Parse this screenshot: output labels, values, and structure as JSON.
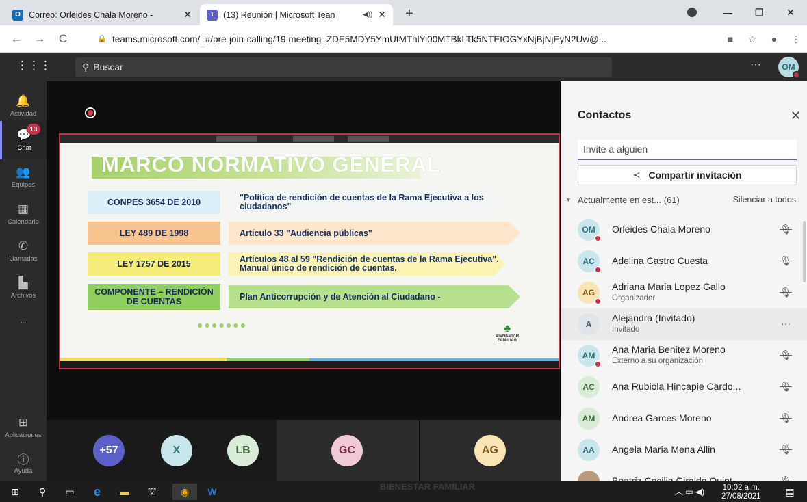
{
  "browser": {
    "tabs": [
      {
        "title": "Correo: Orleides Chala Moreno -",
        "favicon": "outlook-icon",
        "active": false
      },
      {
        "title": "(13) Reunión | Microsoft Tean",
        "favicon": "teams-icon",
        "active": true
      }
    ],
    "new_tab": "+",
    "url": "teams.microsoft.com/_#/pre-join-calling/19:meeting_ZDE5MDY5YmUtMThlYi00MTBkLTk5NTEtOGYxNjBjNjEyN2Uw@..."
  },
  "teams": {
    "search_placeholder": "Buscar",
    "me_initials": "OM",
    "rail": [
      {
        "label": "Actividad",
        "icon": "bell-icon"
      },
      {
        "label": "Chat",
        "icon": "chat-icon",
        "badge": "13",
        "active": true
      },
      {
        "label": "Equipos",
        "icon": "teams-icon"
      },
      {
        "label": "Calendario",
        "icon": "calendar-icon"
      },
      {
        "label": "Llamadas",
        "icon": "phone-icon"
      },
      {
        "label": "Archivos",
        "icon": "file-icon"
      },
      {
        "label": "...",
        "icon": "more-icon"
      }
    ],
    "rail_bottom": [
      {
        "label": "Aplicaciones",
        "icon": "apps-icon"
      },
      {
        "label": "Ayuda",
        "icon": "help-icon"
      }
    ]
  },
  "slide": {
    "title": "MARCO NORMATIVO GENERAL",
    "rows": [
      {
        "left": "CONPES 3654 DE 2010",
        "right": "\"Política de rendición de cuentas de la Rama Ejecutiva a los ciudadanos\"",
        "left_color": "#dbeff8",
        "right_color": "#f4f6f6"
      },
      {
        "left": "LEY 489 DE 1998",
        "right": "Artículo 33 \"Audiencia públicas\"",
        "left_color": "#f7c48f",
        "right_color": "#fde6cc"
      },
      {
        "left": "LEY 1757 DE 2015",
        "right": "Artículos 48 al 59 \"Rendición de cuentas de la Rama Ejecutiva\". Manual único de rendición de cuentas.",
        "left_color": "#f5ec7a",
        "right_color": "#fbf3b4"
      },
      {
        "left": "COMPONENTE – RENDICIÓN DE CUENTAS",
        "right": "Plan Anticorrupción y de Atención al Ciudadano -",
        "left_color": "#8fcf5d",
        "right_color": "#b7e08f"
      }
    ],
    "dots": "●●●●●●●",
    "logo_text": "BIENESTAR FAMILIAR"
  },
  "participants": [
    {
      "initials": "+57",
      "bg": "#5b5fc7",
      "fg": "#ffffff"
    },
    {
      "initials": "X",
      "bg": "#c9e6ec",
      "fg": "#2f6f78"
    },
    {
      "initials": "LB",
      "bg": "#d9ecd7",
      "fg": "#3f6c3c"
    },
    {
      "initials": "GC",
      "bg": "#f2c9d8",
      "fg": "#7c2d4a"
    },
    {
      "initials": "AG",
      "bg": "#f8e4b5",
      "fg": "#7a5618"
    }
  ],
  "contacts": {
    "title": "Contactos",
    "invite_placeholder": "Invite a alguien",
    "share_label": "Compartir invitación",
    "section_label": "Actualmente en est... (61)",
    "mute_all": "Silenciar a todos",
    "people": [
      {
        "initials": "OM",
        "name": "Orleides Chala Moreno",
        "sub": "",
        "bg": "#c9e6ec",
        "fg": "#2f6f78",
        "status": true,
        "action": "mic-off-icon"
      },
      {
        "initials": "AC",
        "name": "Adelina Castro Cuesta",
        "sub": "",
        "bg": "#c9e6ec",
        "fg": "#2f6f78",
        "status": true,
        "action": "mic-off-icon"
      },
      {
        "initials": "AG",
        "name": "Adriana Maria Lopez Gallo",
        "sub": "Organizador",
        "bg": "#f8e4b5",
        "fg": "#7a5618",
        "status": true,
        "action": "mic-off-icon"
      },
      {
        "initials": "A",
        "name": "Alejandra (Invitado)",
        "sub": "Invitado",
        "bg": "#dfe5e8",
        "fg": "#4a5a61",
        "status": false,
        "action": "more-icon"
      },
      {
        "initials": "AM",
        "name": "Ana Maria Benitez Moreno",
        "sub": "Externo a su organización",
        "bg": "#c9e6ec",
        "fg": "#2f6f78",
        "status": true,
        "action": "mic-off-icon"
      },
      {
        "initials": "AC",
        "name": "Ana Rubiola Hincapie Cardo...",
        "sub": "",
        "bg": "#d9ecd7",
        "fg": "#3f6c3c",
        "status": false,
        "action": "mic-off-icon"
      },
      {
        "initials": "AM",
        "name": "Andrea Garces Moreno",
        "sub": "",
        "bg": "#d9ecd7",
        "fg": "#3f6c3c",
        "status": false,
        "action": "mic-off-icon"
      },
      {
        "initials": "AA",
        "name": "Angela Maria Mena Allin",
        "sub": "",
        "bg": "#c9e6ec",
        "fg": "#2f6f78",
        "status": false,
        "action": "mic-off-icon"
      },
      {
        "initials": "",
        "name": "Beatriz Cecilia Giraldo Quint",
        "sub": "",
        "bg": "#b89a7e",
        "fg": "#ffffff",
        "status": false,
        "action": "mic-off-icon"
      }
    ]
  },
  "taskbar": {
    "watermark": "BIENESTAR FAMILIAR",
    "time": "10:02 a.m.",
    "date": "27/08/2021"
  }
}
